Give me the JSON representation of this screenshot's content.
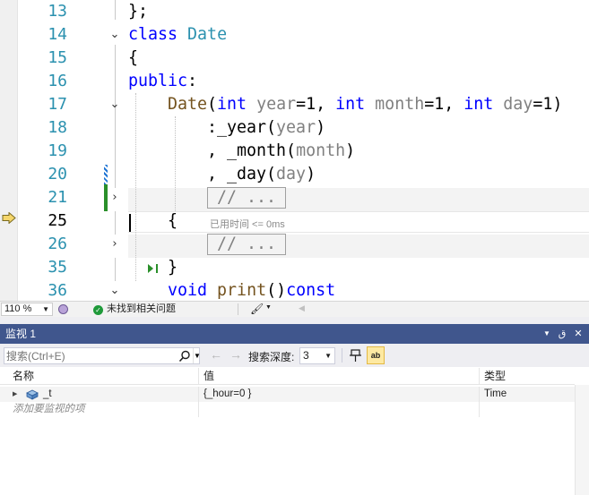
{
  "editor": {
    "lines": [
      {
        "num": "13",
        "text": "};"
      },
      {
        "num": "14",
        "kw": "class",
        "name": "Date"
      },
      {
        "num": "15",
        "text": "{"
      },
      {
        "num": "16",
        "kw": "public",
        "punct": ":"
      },
      {
        "num": "17",
        "fn": "Date",
        "p1": "(",
        "t1": "int",
        "a1": " year",
        "d1": "=1, ",
        "t2": "int",
        "a2": " month",
        "d2": "=1, ",
        "t3": "int",
        "a3": " day",
        "d3": "=1)"
      },
      {
        "num": "18",
        "pre": ":_year(",
        "arg": "year",
        "post": ")"
      },
      {
        "num": "19",
        "pre": ", _month(",
        "arg": "month",
        "post": ")"
      },
      {
        "num": "20",
        "pre": ", _day(",
        "arg": "day",
        "post": ")"
      },
      {
        "num": "21",
        "collapsed": "// ..."
      },
      {
        "num": "25",
        "text": "{"
      },
      {
        "num": "26",
        "collapsed": "// ..."
      },
      {
        "num": "35",
        "text": "}"
      },
      {
        "num": "36",
        "kw": "void",
        "fn": "print",
        "rest": "()",
        "kw2": "const"
      }
    ],
    "perf_hint": "已用时间 <= 0ms"
  },
  "status": {
    "zoom": "110 %",
    "issues": "未找到相关问题"
  },
  "watch": {
    "title": "监视 1",
    "search_placeholder": "搜索(Ctrl+E)",
    "depth_label": "搜索深度:",
    "depth_value": "3",
    "hex_label": "ab",
    "columns": [
      "名称",
      "值",
      "类型"
    ],
    "rows": [
      {
        "name": "_t",
        "value": "{_hour=0 }",
        "type": "Time"
      }
    ],
    "add_item": "添加要监视的项"
  },
  "colors": {
    "keyword": "#0000ff",
    "type": "#2b91af",
    "param": "#808080",
    "function": "#74531f",
    "title_bar": "#40568d"
  }
}
